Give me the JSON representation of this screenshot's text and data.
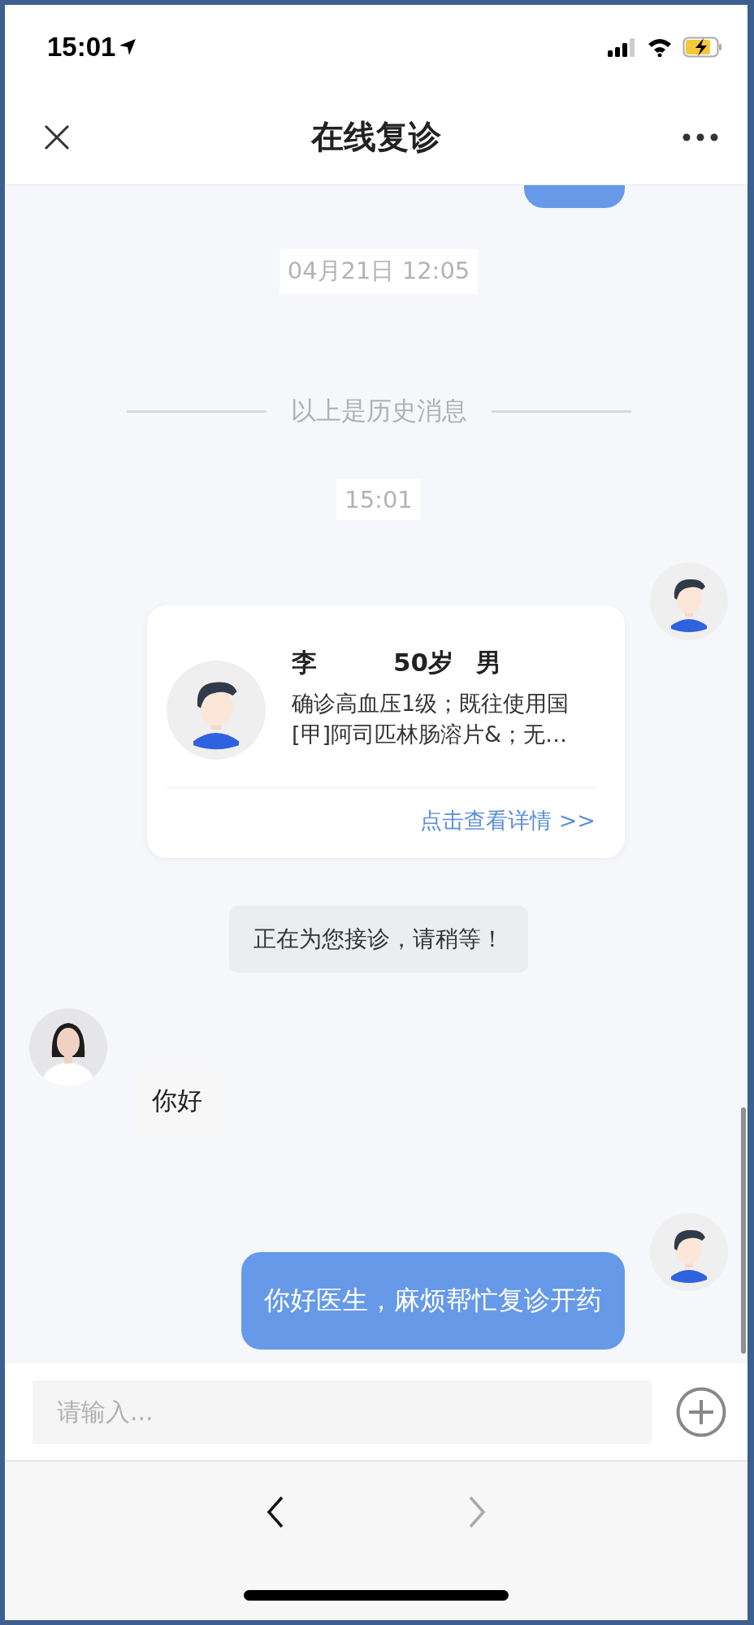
{
  "status_bar": {
    "time": "15:01"
  },
  "nav": {
    "title": "在线复诊"
  },
  "messages": [
    {
      "kind": "cut_bubble",
      "outgoing": true
    },
    {
      "kind": "time",
      "text": "04月21日 12:05"
    },
    {
      "kind": "divider",
      "text": "以上是历史消息"
    },
    {
      "kind": "time",
      "text": "15:01"
    },
    {
      "kind": "card",
      "outgoing": true,
      "name": "李",
      "age": "50岁",
      "gender": "男",
      "summary": "确诊高血压1级；既往使用国[甲]阿司匹林肠溶片&；无…",
      "link": "点击查看详情 >>"
    },
    {
      "kind": "notice",
      "text": "正在为您接诊，请稍等！"
    },
    {
      "kind": "text",
      "outgoing": false,
      "text": "你好"
    },
    {
      "kind": "text",
      "outgoing": true,
      "text": "你好医生，麻烦帮忙复诊开药"
    }
  ],
  "input": {
    "placeholder": "请输入..."
  },
  "browser_nav": [
    {
      "kind": "back",
      "disabled": false
    },
    {
      "kind": "forward",
      "disabled": true
    }
  ]
}
